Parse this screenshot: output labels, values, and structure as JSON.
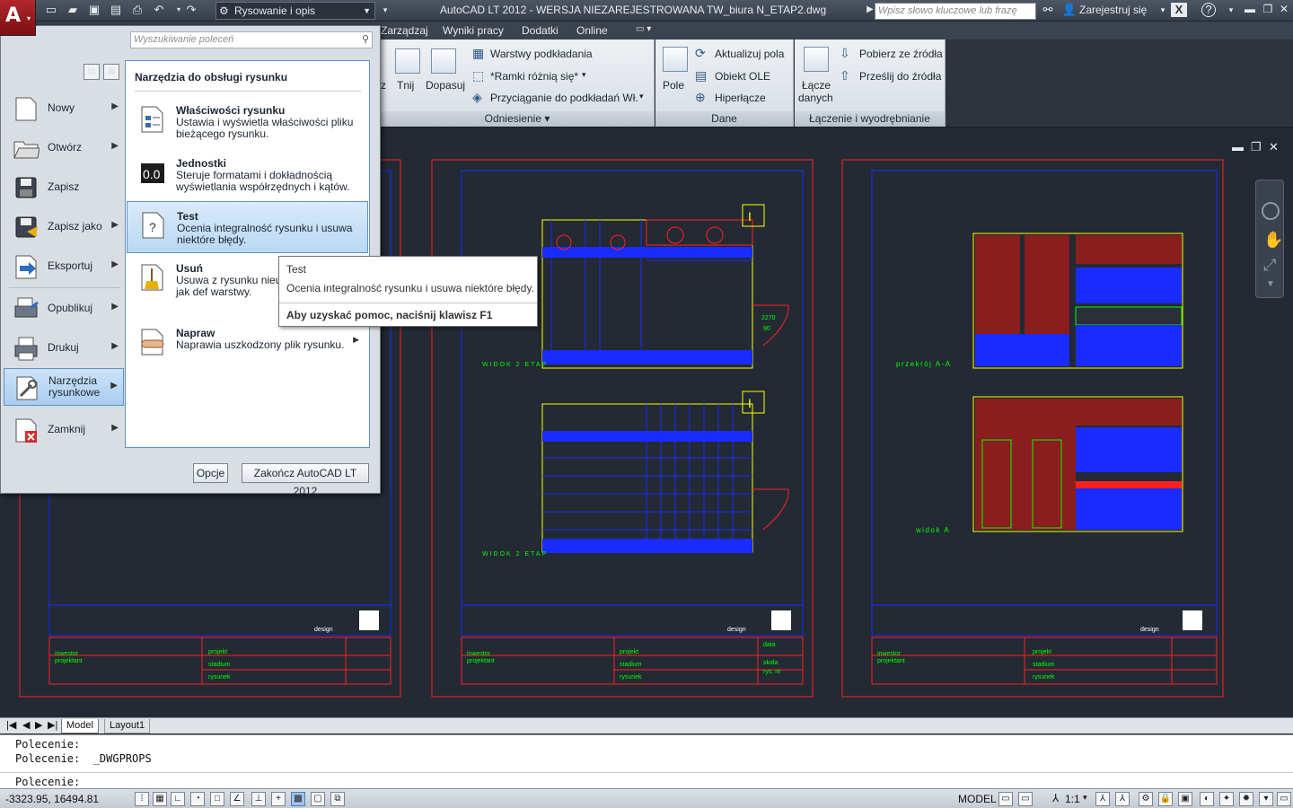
{
  "window": {
    "title": "AutoCAD LT 2012 - WERSJA NIEZAREJESTROWANA    TW_biura N_ETAP2.dwg",
    "workspace": "Rysowanie i opis",
    "search_placeholder": "Wpisz słowo kluczowe lub frazę",
    "register": "Zarejestruj się",
    "help": "?"
  },
  "ribbon_tabs": [
    "Zarządzaj",
    "Wyniki pracy",
    "Dodatki",
    "Online"
  ],
  "ribbon": {
    "partial_labels": [
      "z",
      "Tnij",
      "Dopasuj"
    ],
    "reference_panel": {
      "title": "Odniesienie",
      "items": [
        "Warstwy podkładania",
        "*Ramki różnią się*",
        "Przyciąganie do podkładań Wł."
      ]
    },
    "data_panel": {
      "title": "Dane",
      "big_button": "Pole",
      "items": [
        "Aktualizuj  pola",
        "Obiekt OLE",
        "Hiperłącze"
      ]
    },
    "link_panel": {
      "title": "Łączenie i wyodrębnianie",
      "big_button_line1": "Łącze",
      "big_button_line2": "danych",
      "items": [
        "Pobierz ze źródła",
        "Prześlij do źródła"
      ]
    }
  },
  "app_menu": {
    "search_placeholder": "Wyszukiwanie poleceń",
    "left_items": [
      {
        "label": "Nowy",
        "icon": "new-file-icon"
      },
      {
        "label": "Otwórz",
        "icon": "open-folder-icon"
      },
      {
        "label": "Zapisz",
        "icon": "save-icon"
      },
      {
        "label": "Zapisz jako",
        "icon": "save-as-icon"
      },
      {
        "label": "Eksportuj",
        "icon": "export-icon"
      },
      {
        "label": "Opublikuj",
        "icon": "publish-icon"
      },
      {
        "label": "Drukuj",
        "icon": "print-icon"
      },
      {
        "label_line1": "Narzędzia",
        "label_line2": "rysunkowe",
        "icon": "drawing-utilities-icon"
      },
      {
        "label": "Zamknij",
        "icon": "close-file-icon"
      }
    ],
    "submenu": {
      "title": "Narzędzia do obsługi rysunku",
      "items": [
        {
          "title": "Właściwości rysunku",
          "desc": "Ustawia i wyświetla właściwości pliku bieżącego rysunku.",
          "icon": "drawing-properties-icon"
        },
        {
          "title": "Jednostki",
          "desc": "Steruje formatami i dokładnością wyświetlania współrzędnych i kątów.",
          "icon": "units-icon",
          "icon_text": "0.0"
        },
        {
          "title": "Test",
          "desc": "Ocenia integralność rysunku i usuwa niektóre błędy.",
          "icon": "audit-icon",
          "icon_text": "?"
        },
        {
          "title": "Usuń",
          "desc": "Usuwa z rysunku nieu nazwane, takie jak def warstwy.",
          "icon": "purge-icon"
        },
        {
          "title": "Napraw",
          "desc": "Naprawia uszkodzony plik rysunku.",
          "icon": "recover-icon"
        }
      ]
    },
    "buttons": {
      "options": "Opcje",
      "exit": "Zakończ AutoCAD LT 2012"
    }
  },
  "tooltip": {
    "title": "Test",
    "desc": "Ocenia integralność rysunku i usuwa niektóre błędy.",
    "help": "Aby uzyskać pomoc, naciśnij klawisz F1"
  },
  "layout_tabs": [
    "Model",
    "Layout1"
  ],
  "command_line": {
    "history": [
      "Polecenie:",
      "Polecenie:  _DWGPROPS"
    ],
    "prompt": "Polecenie:"
  },
  "status_bar": {
    "coordinates": "-3323.95, 16494.81",
    "model": "MODEL",
    "scale": "1:1"
  },
  "drawing": {
    "sheet2": {
      "view_top": "WIDOK 2 ETAP",
      "view_bottom": "WIDOK 2 ETAP",
      "door_dim_top": "2270\n90",
      "section_label": "I"
    },
    "sheet3": {
      "section": "przekrój  A-A",
      "view": "widok  A"
    },
    "titleblock": {
      "investor": "inwestor",
      "designer": "projektant",
      "project": "projekt",
      "stage": "stadium",
      "drawing": "rysunek",
      "date": "data",
      "scale": "skala",
      "drawing_no": "rys. nr",
      "logo": "design"
    }
  },
  "colors": {
    "accent_blue": "#5e93c5",
    "app_red": "#b3262a",
    "cad_green": "#00ff00",
    "cad_red": "#ff2020",
    "cad_blue": "#1a2bff",
    "cad_yellow": "#ffff00"
  }
}
